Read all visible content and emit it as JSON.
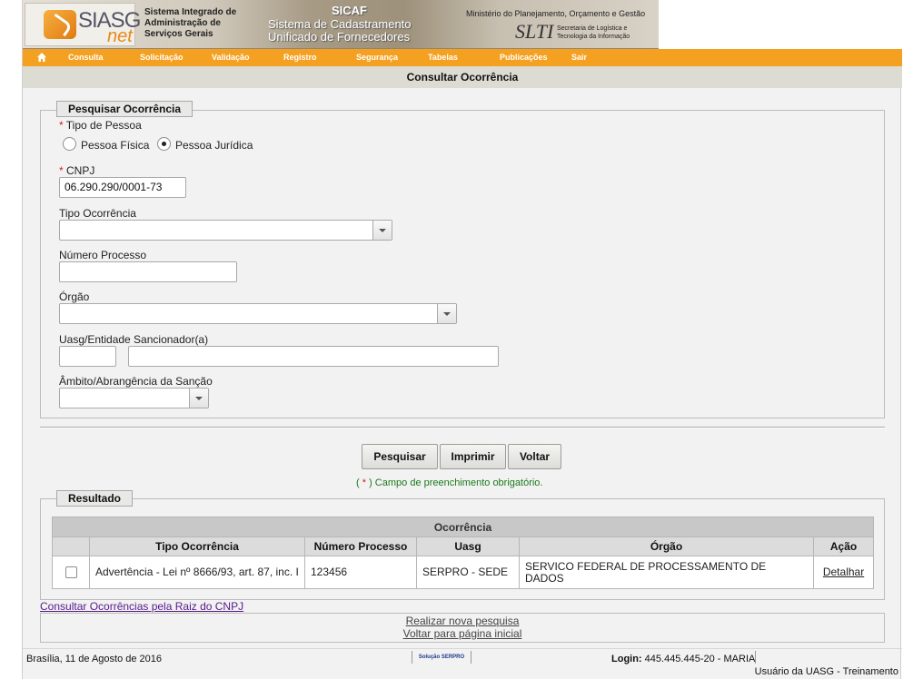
{
  "banner": {
    "logo_main": "SIASG",
    "logo_sub": "net",
    "siasg_desc": [
      "Sistema Integrado de",
      "Administração de",
      "Serviços Gerais"
    ],
    "sicaf_title": "SICAF",
    "sicaf_sub": [
      "Sistema de Cadastramento",
      "Unificado de Fornecedores"
    ],
    "ministerio": "Ministério do Planejamento, Orçamento e Gestão",
    "slti": "SLTI",
    "slti_desc": [
      "Secretaria de Logística e",
      "Tecnologia da Informação"
    ]
  },
  "menu": [
    "Consulta",
    "Solicitação",
    "Validação",
    "Registro",
    "Segurança",
    "Tabelas",
    "Publicações",
    "Sair"
  ],
  "page_title": "Consultar Ocorrência",
  "search": {
    "legend": "Pesquisar Ocorrência",
    "required_mark": "*",
    "tipo_pessoa_label": "Tipo de Pessoa",
    "radio_fisica": "Pessoa Física",
    "radio_juridica": "Pessoa Jurídica",
    "selected_radio": "Pessoa Jurídica",
    "cnpj_label": "CNPJ",
    "cnpj_value": "06.290.290/0001-73",
    "tipo_ocorrencia_label": "Tipo Ocorrência",
    "tipo_ocorrencia_value": "",
    "numero_processo_label": "Número Processo",
    "numero_processo_value": "",
    "orgao_label": "Órgão",
    "orgao_value": "",
    "uasg_label": "Uasg/Entidade Sancionador(a)",
    "uasg_code": "",
    "uasg_name": "",
    "ambito_label": "Âmbito/Abrangência da Sanção",
    "ambito_value": ""
  },
  "buttons": {
    "pesquisar": "Pesquisar",
    "imprimir": "Imprimir",
    "voltar": "Voltar"
  },
  "required_note": {
    "open": "(",
    "mark": " * ",
    "close": ")",
    "text": " Campo de preenchimento obrigatório."
  },
  "result": {
    "legend": "Resultado",
    "caption": "Ocorrência",
    "columns": [
      "Tipo Ocorrência",
      "Número Processo",
      "Uasg",
      "Órgão",
      "Ação"
    ],
    "rows": [
      {
        "tipo": "Advertência - Lei nº 8666/93, art. 87, inc. I",
        "processo": "123456",
        "uasg": "SERPRO - SEDE",
        "orgao": "SERVICO FEDERAL DE PROCESSAMENTO DE DADOS",
        "acao": "Detalhar"
      }
    ]
  },
  "links": {
    "raiz_cnpj": "Consultar Ocorrências pela Raiz do CNPJ",
    "nova_pesquisa": "Realizar nova pesquisa",
    "pagina_inicial": "Voltar para página inicial"
  },
  "footer": {
    "date": "Brasília, 11 de Agosto de 2016",
    "logo": "Solução SERPRO",
    "login_label": "Login:",
    "login_value": " 445.445.445-20  - MARIA",
    "user_type": "Usuário da UASG - Treinamento"
  },
  "colors": {
    "menu_bg": "#f4a020",
    "title_bar_bg": "#dcdcd2",
    "required": "#d32020",
    "note_green": "#1a7a1a",
    "visited_link": "#551a8b"
  }
}
